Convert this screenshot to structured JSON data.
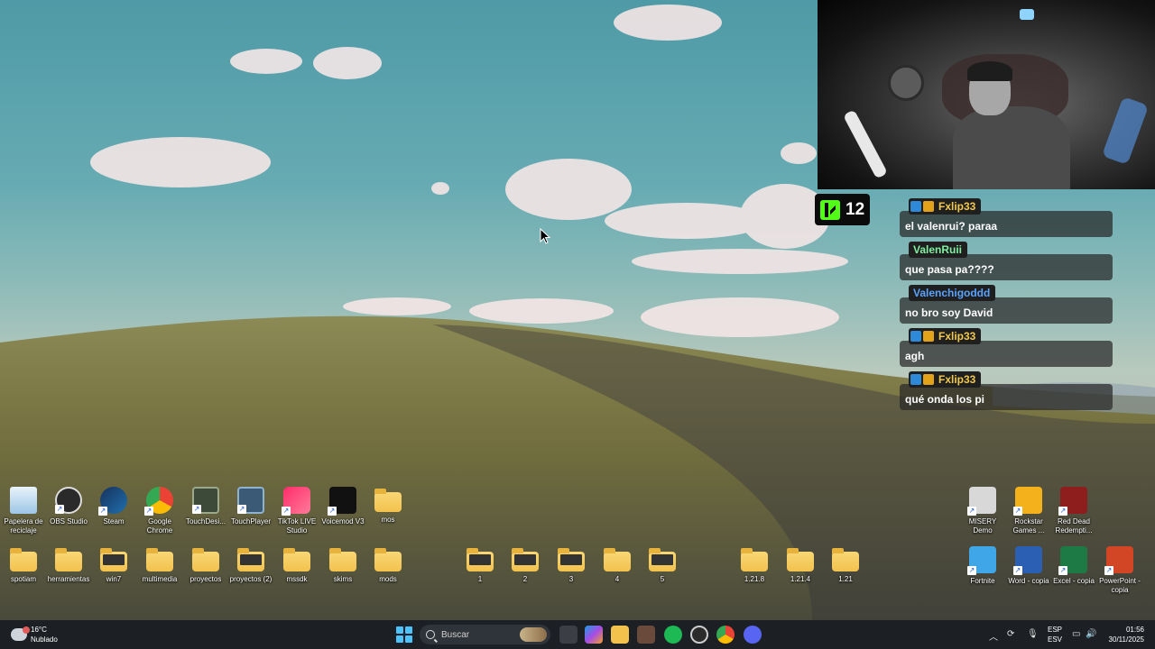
{
  "chat": {
    "viewer_count": "12",
    "messages": [
      {
        "user": "Fxlip33",
        "user_color": "#f2c94c",
        "badges": true,
        "text": "el valenrui? paraa"
      },
      {
        "user": "ValenRuii",
        "user_color": "#7ef0a0",
        "badges": false,
        "text": "que pasa pa????"
      },
      {
        "user": "Valenchigoddd",
        "user_color": "#5aa2ff",
        "badges": false,
        "text": "no bro soy David"
      },
      {
        "user": "Fxlip33",
        "user_color": "#f2c94c",
        "badges": true,
        "text": "agh"
      },
      {
        "user": "Fxlip33",
        "user_color": "#f2c94c",
        "badges": true,
        "text": "qué onda los pi"
      }
    ]
  },
  "desktop": {
    "row1": [
      {
        "label": "Papelera de reciclaje",
        "icon": "recycle-bin-icon"
      },
      {
        "label": "OBS Studio",
        "icon": "obs-icon"
      },
      {
        "label": "Steam",
        "icon": "steam-icon"
      },
      {
        "label": "Google Chrome",
        "icon": "chrome-icon"
      },
      {
        "label": "TouchDesi...",
        "icon": "touchdesigner-icon"
      },
      {
        "label": "TouchPlayer",
        "icon": "touchplayer-icon"
      },
      {
        "label": "TikTok LIVE Studio",
        "icon": "tiktok-icon"
      },
      {
        "label": "Voicemod V3",
        "icon": "voicemod-icon"
      },
      {
        "label": "mos",
        "icon": "folder-icon"
      }
    ],
    "row2": [
      {
        "label": "spotiam",
        "icon": "folder-icon"
      },
      {
        "label": "herramientas",
        "icon": "folder-icon"
      },
      {
        "label": "win7",
        "icon": "folder-icon"
      },
      {
        "label": "multimedia",
        "icon": "folder-icon"
      },
      {
        "label": "proyectos",
        "icon": "folder-icon"
      },
      {
        "label": "proyectos (2)",
        "icon": "folder-icon"
      },
      {
        "label": "mssdk",
        "icon": "folder-icon"
      },
      {
        "label": "skims",
        "icon": "folder-icon"
      },
      {
        "label": "mods",
        "icon": "folder-icon"
      }
    ],
    "numbered": [
      {
        "label": "1",
        "icon": "folder-icon"
      },
      {
        "label": "2",
        "icon": "folder-icon"
      },
      {
        "label": "3",
        "icon": "folder-icon"
      },
      {
        "label": "4",
        "icon": "folder-icon"
      },
      {
        "label": "5",
        "icon": "folder-icon"
      }
    ],
    "versions": [
      {
        "label": "1.21.8",
        "icon": "folder-icon"
      },
      {
        "label": "1.21.4",
        "icon": "folder-icon"
      },
      {
        "label": "1.21",
        "icon": "folder-icon"
      }
    ],
    "right_row1": [
      {
        "label": "MISERY Demo",
        "icon": "misery-icon"
      },
      {
        "label": "Rockstar Games ...",
        "icon": "rockstar-icon"
      },
      {
        "label": "Red Dead Redempti...",
        "icon": "rdr-icon"
      }
    ],
    "right_row2": [
      {
        "label": "Fortnite",
        "icon": "fortnite-icon"
      },
      {
        "label": "Word - copia",
        "icon": "word-icon"
      },
      {
        "label": "Excel - copia",
        "icon": "excel-icon"
      },
      {
        "label": "PowerPoint - copia",
        "icon": "powerpoint-icon"
      }
    ]
  },
  "taskbar": {
    "weather_temp": "16°C",
    "weather_desc": "Nublado",
    "search_placeholder": "Buscar",
    "lang_line1": "ESP",
    "lang_line2": "ESV",
    "time": "01:56",
    "date": "30/11/2025",
    "colors": {
      "accent": "#4cc2ff",
      "bar": "#1c2024"
    }
  }
}
